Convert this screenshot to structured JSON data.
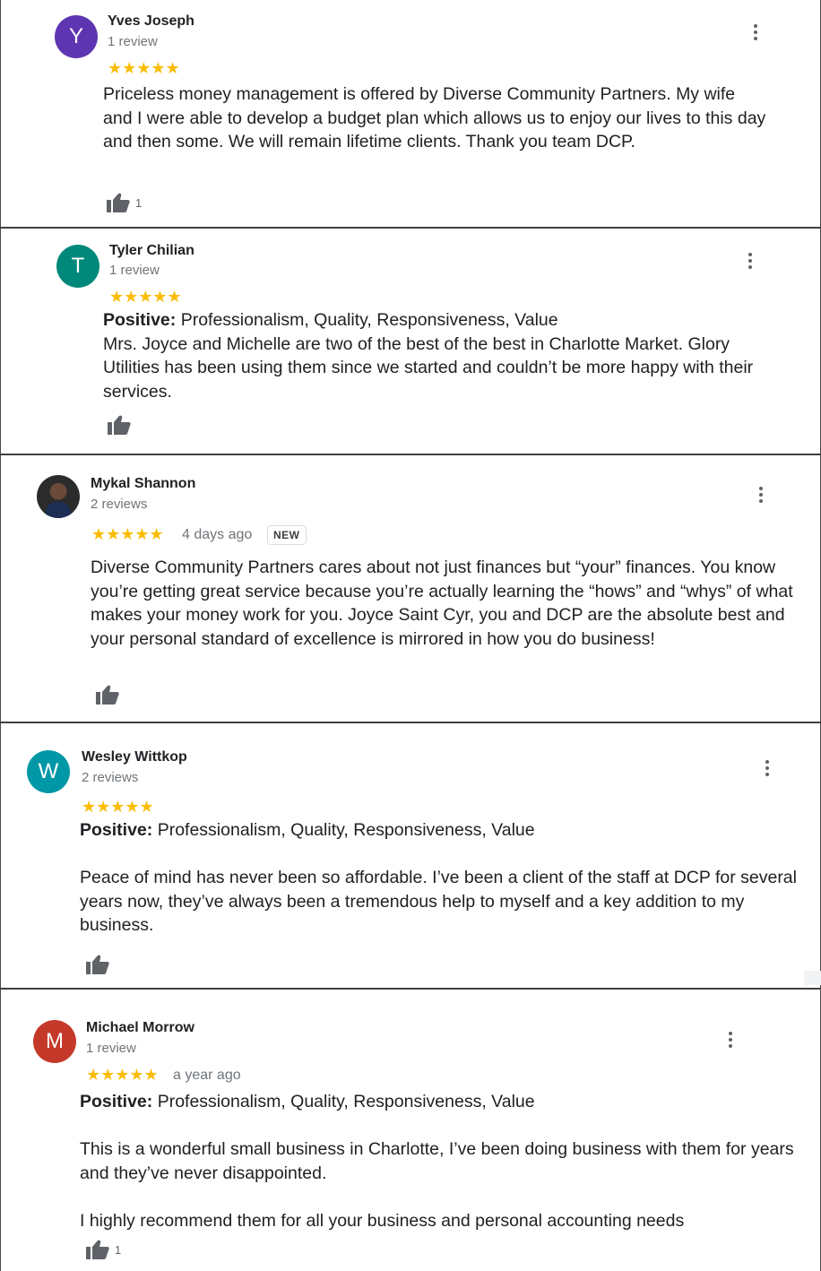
{
  "colors": {
    "star": "#fbbc04",
    "avatar_y": "#5e35b1",
    "avatar_t": "#00897b",
    "avatar_w": "#0097a7",
    "avatar_m": "#c5392a"
  },
  "icons": {
    "like": "thumbs-up-icon",
    "more": "more-vert-icon",
    "stars": "star-rating-icon"
  },
  "reviews": [
    {
      "initial": "Y",
      "name": "Yves Joseph",
      "count": "1 review",
      "stars": "★★★★★",
      "rating": 5,
      "text": "Priceless money management is offered by Diverse Community Partners. My wife and I were able to develop a budget plan which allows us to enjoy our lives to this day and then some. We will remain lifetime clients. Thank you team DCP.",
      "likes": "1"
    },
    {
      "initial": "T",
      "name": "Tyler Chilian",
      "count": "1 review",
      "stars": "★★★★★",
      "rating": 5,
      "positive_label": "Positive:",
      "positive_list": "Professionalism, Quality, Responsiveness, Value",
      "text": "Mrs. Joyce and Michelle are two of the best of the best in Charlotte Market. Glory Utilities has been using them since we started and couldn’t be more happy with their services."
    },
    {
      "name": "Mykal Shannon",
      "count": "2 reviews",
      "stars": "★★★★★",
      "rating": 5,
      "when": "4 days ago",
      "badge": "NEW",
      "text": "Diverse Community Partners cares about not just finances but “your” finances. You know you’re getting great service because you’re actually learning the “hows” and “whys” of what makes your money work for you.  Joyce Saint Cyr, you and DCP are the absolute best and your personal standard of excellence is mirrored in how you do business!"
    },
    {
      "initial": "W",
      "name": "Wesley Wittkop",
      "count": "2 reviews",
      "stars": "★★★★★",
      "rating": 5,
      "positive_label": "Positive:",
      "positive_list": "Professionalism, Quality, Responsiveness, Value",
      "text": "Peace of mind has never been so affordable. I’ve been a client of the staff at DCP for several years now, they’ve always been a tremendous help to myself and a key addition to my business."
    },
    {
      "initial": "M",
      "name": "Michael Morrow",
      "count": "1 review",
      "stars": "★★★★★",
      "rating": 5,
      "when": "a year ago",
      "positive_label": "Positive:",
      "positive_list": "Professionalism, Quality, Responsiveness, Value",
      "text": "This is a wonderful small business in Charlotte, I’ve been doing business with them for years and they’ve never disappointed.",
      "text2": "I highly recommend them for all your business and personal accounting needs",
      "likes": "1"
    }
  ]
}
